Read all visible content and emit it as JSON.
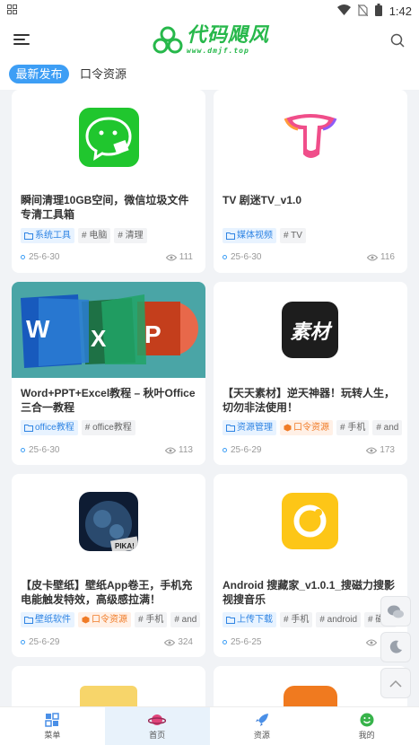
{
  "status_bar": {
    "left_icon": "grid-icon",
    "time": "1:42"
  },
  "header": {
    "logo_text": "代码飓风",
    "logo_sub": "www.dmjf.top"
  },
  "tabs": [
    {
      "label": "最新发布"
    },
    {
      "label": "口令资源"
    }
  ],
  "cards": [
    {
      "title": "瞬间清理10GB空间，微信垃圾文件专清工具箱",
      "tags": [
        {
          "type": "cat",
          "label": "系统工具"
        },
        {
          "type": "hash",
          "label": "# 电脑"
        },
        {
          "type": "hash",
          "label": "# 清理"
        }
      ],
      "date": "25-6-30",
      "views": "111"
    },
    {
      "title": "TV 剧迷TV_v1.0",
      "tags": [
        {
          "type": "cat",
          "label": "媒体视频"
        },
        {
          "type": "hash",
          "label": "# TV"
        }
      ],
      "date": "25-6-30",
      "views": "116"
    },
    {
      "title": "Word+PPT+Excel教程 – 秋叶Office三合一教程",
      "tags": [
        {
          "type": "cat",
          "label": "office教程"
        },
        {
          "type": "hash",
          "label": "# office教程"
        }
      ],
      "date": "25-6-30",
      "views": "113"
    },
    {
      "title": "【天天素材】逆天神器！玩转人生，切勿非法使用！",
      "tags": [
        {
          "type": "cat",
          "label": "资源管理"
        },
        {
          "type": "src",
          "label": "口令资源"
        },
        {
          "type": "hash",
          "label": "# 手机"
        },
        {
          "type": "hash",
          "label": "# and"
        }
      ],
      "date": "25-6-29",
      "views": "173"
    },
    {
      "title": "【皮卡壁纸】壁纸App卷王，手机充电能触发特效，高级感拉满！",
      "tags": [
        {
          "type": "cat",
          "label": "壁纸软件"
        },
        {
          "type": "src",
          "label": "口令资源"
        },
        {
          "type": "hash",
          "label": "# 手机"
        },
        {
          "type": "hash",
          "label": "# and"
        }
      ],
      "date": "25-6-29",
      "views": "324"
    },
    {
      "title": "Android 搜藏家_v1.0.1_搜磁力搜影视搜音乐",
      "tags": [
        {
          "type": "cat",
          "label": "上传下载"
        },
        {
          "type": "hash",
          "label": "# 手机"
        },
        {
          "type": "hash",
          "label": "# android"
        },
        {
          "type": "hash",
          "label": "# 磁力"
        }
      ],
      "date": "25-6-25",
      "views": "157"
    }
  ],
  "thumb_labels": {
    "sucai": "素材",
    "pika": "PIKA!"
  },
  "bottom_nav": [
    {
      "label": "菜单",
      "icon": "menu-grid-icon"
    },
    {
      "label": "首页",
      "icon": "planet-icon"
    },
    {
      "label": "资源",
      "icon": "rocket-icon"
    },
    {
      "label": "我的",
      "icon": "smile-icon"
    }
  ]
}
